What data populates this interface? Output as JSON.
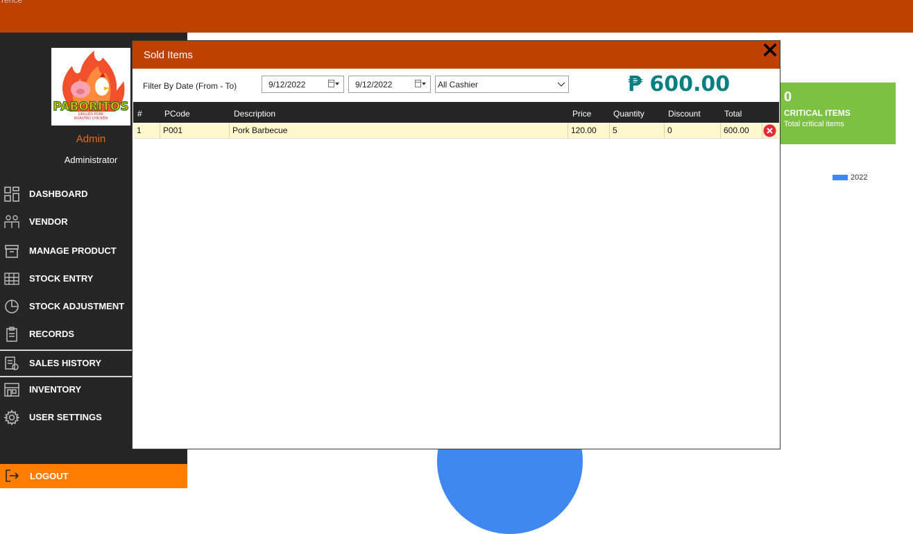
{
  "window": {
    "title_fragment": "rence"
  },
  "sidebar": {
    "user": {
      "name": "Admin",
      "role": "Administrator"
    },
    "items": [
      {
        "label": "DASHBOARD",
        "icon": "dashboard-icon"
      },
      {
        "label": "VENDOR",
        "icon": "vendor-icon"
      },
      {
        "label": "MANAGE PRODUCT",
        "icon": "product-icon"
      },
      {
        "label": "STOCK ENTRY",
        "icon": "stock-entry-icon"
      },
      {
        "label": "STOCK ADJUSTMENT",
        "icon": "stock-adjustment-icon"
      },
      {
        "label": "RECORDS",
        "icon": "records-icon"
      },
      {
        "label": "SALES HISTORY",
        "icon": "sales-history-icon",
        "active": true
      },
      {
        "label": "INVENTORY",
        "icon": "inventory-icon"
      },
      {
        "label": "USER SETTINGS",
        "icon": "gear-icon"
      }
    ],
    "logout": "LOGOUT"
  },
  "logo": {
    "text": "PABORITOS",
    "tagline1": "GRILLED PORK",
    "tagline2": "ROASTED CHICKEN"
  },
  "dashboard": {
    "card": {
      "count": "0",
      "title": "CRITICAL ITEMS",
      "subtitle": "Total critical items",
      "color": "#7dc142"
    },
    "legend": {
      "label": "2022",
      "color": "#3f88f0"
    }
  },
  "modal": {
    "title": "Sold Items",
    "filter_label": "Filter By Date (From - To)",
    "date_from": "9/12/2022",
    "date_to": "9/12/2022",
    "cashier": "All Cashier",
    "total": "₱ 600.00",
    "columns": [
      "#",
      "PCode",
      "Description",
      "Price",
      "Quantity",
      "Discount",
      "Total"
    ],
    "rows": [
      {
        "num": "1",
        "pcode": "P001",
        "description": "Pork Barbecue",
        "price": "120.00",
        "quantity": "5",
        "discount": "0",
        "total": "600.00"
      }
    ]
  },
  "colors": {
    "header": "#bf4100",
    "sidebar": "#262626",
    "accent": "#ff7e00",
    "total": "#087f80"
  }
}
